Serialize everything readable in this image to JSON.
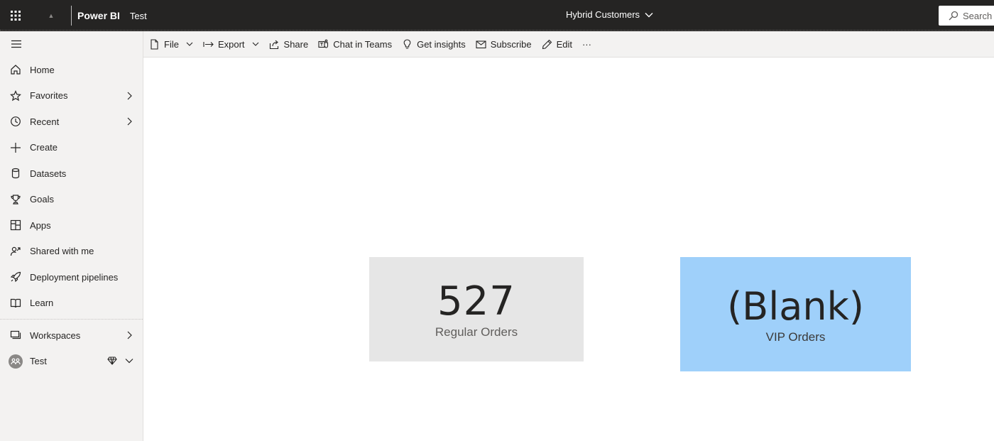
{
  "header": {
    "brand": "Power BI",
    "workspace": "Test",
    "report_title": "Hybrid Customers",
    "search_placeholder": "Search"
  },
  "sidebar": {
    "items": [
      {
        "label": "Home",
        "icon": "home-icon"
      },
      {
        "label": "Favorites",
        "icon": "star-icon",
        "has_chevron": true
      },
      {
        "label": "Recent",
        "icon": "clock-icon",
        "has_chevron": true
      },
      {
        "label": "Create",
        "icon": "plus-icon"
      },
      {
        "label": "Datasets",
        "icon": "database-icon"
      },
      {
        "label": "Goals",
        "icon": "trophy-icon"
      },
      {
        "label": "Apps",
        "icon": "apps-icon"
      },
      {
        "label": "Shared with me",
        "icon": "shared-icon"
      },
      {
        "label": "Deployment pipelines",
        "icon": "rocket-icon"
      },
      {
        "label": "Learn",
        "icon": "book-icon"
      }
    ],
    "workspaces_label": "Workspaces",
    "current_workspace": "Test"
  },
  "toolbar": {
    "file": "File",
    "export": "Export",
    "share": "Share",
    "chat_in_teams": "Chat in Teams",
    "get_insights": "Get insights",
    "subscribe": "Subscribe",
    "edit": "Edit",
    "more": "···"
  },
  "cards": [
    {
      "value": "527",
      "label": "Regular Orders",
      "background": "#e6e6e6"
    },
    {
      "value": "(Blank)",
      "label": "VIP Orders",
      "background": "#9fd0fa"
    }
  ],
  "colors": {
    "topbar": "#252423",
    "nav_background": "#f3f2f1"
  }
}
